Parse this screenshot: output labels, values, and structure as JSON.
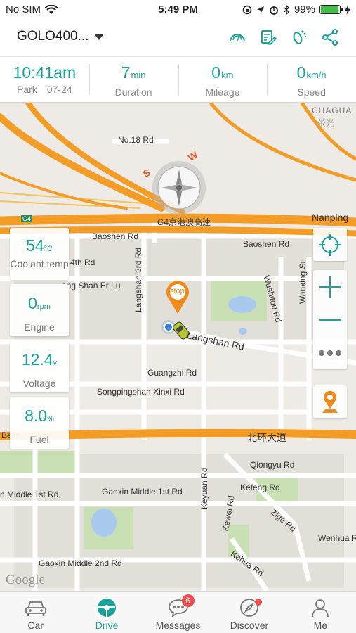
{
  "status_bar": {
    "carrier": "No SIM",
    "time": "5:49 PM",
    "battery": "99%",
    "battery_level": 0.99
  },
  "header": {
    "device_name": "GOLO400..."
  },
  "stats": [
    {
      "value": "10:41am",
      "unit": "",
      "label": "Park",
      "extra": "07-24"
    },
    {
      "value": "7",
      "unit": "min",
      "label": "Duration",
      "extra": ""
    },
    {
      "value": "0",
      "unit": "km",
      "label": "Mileage",
      "extra": ""
    },
    {
      "value": "0",
      "unit": "km/h",
      "label": "Speed",
      "extra": ""
    }
  ],
  "cards": [
    {
      "value": "54",
      "unit": "°C",
      "label": "Coolant temp"
    },
    {
      "value": "0",
      "unit": "rpm",
      "label": "Engine"
    },
    {
      "value": "12.4",
      "unit": "v",
      "label": "Voltage"
    },
    {
      "value": "8.0",
      "unit": "%",
      "label": "Fuel"
    }
  ],
  "map": {
    "labels": {
      "chaguang": "CHAGUA",
      "chaguang_cn": "茶光",
      "no18": "No.18 Rd",
      "nanping": "Nanping",
      "g4": "G4",
      "jinggang": "G4京港澳高速",
      "baoshen1": "Baoshen Rd",
      "baoshen2": "Baoshen Rd",
      "fourth": "4th Rd",
      "langshan_er": "ang Shan Er Lu",
      "langshan3": "Langshan 3rd Rd",
      "wushitou": "Wushitou Rd",
      "wanxing": "Wanxing St",
      "langshan": "Langshan Rd",
      "guangzhi": "Guangzhi Rd",
      "songpingshan": "Songpingshan Xinxi Rd",
      "beihuan": "北环大道",
      "beihuan_left": "Beihu",
      "qiongyu": "Qiongyu Rd",
      "keyuan": "Keyuan Rd",
      "kefeng": "Kefeng Rd",
      "gaoxin_middle_1st": "Gaoxin Middle 1st Rd",
      "gaoxin_middle_1st_left": "n Middle 1st Rd",
      "kewei": "Kewei Rd",
      "zige": "Zige Rd",
      "wenhua": "Wenhua R",
      "kehua": "Kehua Rd",
      "gaoxin_middle_2nd": "Gaoxin Middle 2nd Rd",
      "compass_s": "S",
      "compass_w": "W",
      "stop_pin": "stop",
      "google": "Google"
    }
  },
  "tabs": [
    {
      "label": "Car"
    },
    {
      "label": "Drive"
    },
    {
      "label": "Messages",
      "badge": "6"
    },
    {
      "label": "Discover"
    },
    {
      "label": "Me"
    }
  ],
  "colors": {
    "accent": "#1aa39b",
    "highway": "#f39c26",
    "badge": "#f14b4b",
    "park": "#c8e0b4",
    "water": "#a9c9ef"
  }
}
